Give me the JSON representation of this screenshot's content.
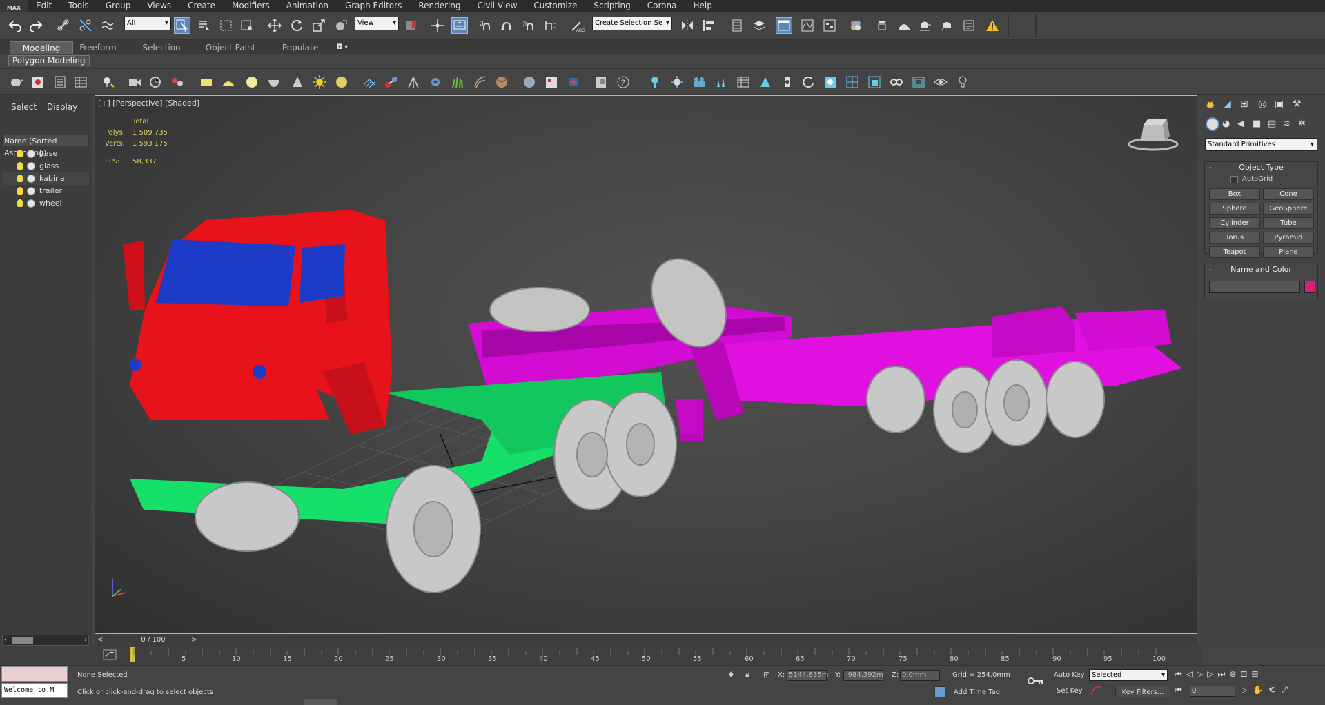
{
  "app": {
    "logo": "MAX"
  },
  "menu": [
    "Edit",
    "Tools",
    "Group",
    "Views",
    "Create",
    "Modifiers",
    "Animation",
    "Graph Editors",
    "Rendering",
    "Civil View",
    "Customize",
    "Scripting",
    "Corona",
    "Help"
  ],
  "toolbar": {
    "filter_value": "All",
    "refcoord_value": "View",
    "selection_set_placeholder": "Create Selection Se",
    "snap_labels": [
      "3",
      "%"
    ]
  },
  "ribbon": {
    "tabs": [
      "Modeling",
      "Freeform",
      "Selection",
      "Object Paint",
      "Populate"
    ],
    "active_tab": "Modeling",
    "panel_label": "Polygon Modeling"
  },
  "scene_explorer": {
    "tabs": [
      "Select",
      "Display"
    ],
    "column_header": "Name (Sorted Ascending)",
    "items": [
      {
        "name": "base"
      },
      {
        "name": "glass"
      },
      {
        "name": "kabina"
      },
      {
        "name": "trailer"
      },
      {
        "name": "wheel"
      }
    ]
  },
  "viewport": {
    "label": "[+] [Perspective] [Shaded]",
    "stats": {
      "total_label": "Total",
      "polys_label": "Polys:",
      "polys_value": "1 509 735",
      "verts_label": "Verts:",
      "verts_value": "1 593 175",
      "fps_label": "FPS:",
      "fps_value": "58,337"
    },
    "colors": {
      "cab": "#e8121a",
      "glass": "#1c3cc8",
      "chassis": "#15e06a",
      "trailer": "#e010e0",
      "wheels": "#c8c8c8"
    }
  },
  "command_panel": {
    "dropdown_value": "Standard Primitives",
    "object_type": {
      "title": "Object Type",
      "autogrid_label": "AutoGrid",
      "buttons": [
        "Box",
        "Cone",
        "Sphere",
        "GeoSphere",
        "Cylinder",
        "Tube",
        "Torus",
        "Pyramid",
        "Teapot",
        "Plane"
      ]
    },
    "name_and_color": {
      "title": "Name and Color",
      "name_value": "",
      "swatch_color": "#d6207a"
    }
  },
  "timeline": {
    "slider_label": "0 / 100",
    "ticks": [
      "5",
      "10",
      "15",
      "20",
      "25",
      "30",
      "35",
      "40",
      "45",
      "50",
      "55",
      "60",
      "65",
      "70",
      "75",
      "80",
      "85",
      "90",
      "95",
      "100"
    ]
  },
  "status": {
    "listener_text": "Welcome to M",
    "selection_status": "None Selected",
    "prompt": "Click or click-and-drag to select objects",
    "x_label": "X:",
    "x_value": "5144,635m",
    "y_label": "Y:",
    "y_value": "-984,392m",
    "z_label": "Z:",
    "z_value": "0,0mm",
    "grid": "Grid = 254,0mm",
    "add_time_tag": "Add Time Tag",
    "auto_key": "Auto Key",
    "set_key": "Set Key",
    "key_mode_value": "Selected",
    "key_filters": "Key Filters...",
    "frame_value": "0"
  }
}
